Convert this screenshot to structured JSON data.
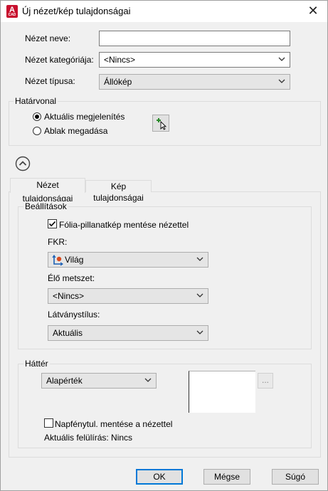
{
  "window": {
    "title": "Új nézet/kép tulajdonságai",
    "close_glyph": "✕",
    "app_icon_letter": "A",
    "app_icon_sub": "CAD"
  },
  "form": {
    "view_name_label": "Nézet neve:",
    "view_name_value": "",
    "view_category_label": "Nézet kategóriája:",
    "view_category_value": "<Nincs>",
    "view_type_label": "Nézet típusa:",
    "view_type_value": "Állókép"
  },
  "boundary": {
    "title": "Határvonal",
    "option_current": "Aktuális megjelenítés",
    "option_window": "Ablak megadása",
    "selected": "current"
  },
  "tabs": {
    "view_props": "Nézet tulajdonságai",
    "image_props": "Kép tulajdonságai",
    "active": "view_props"
  },
  "settings": {
    "title": "Beállítások",
    "save_layer_snapshot_label": "Fólia-pillanatkép mentése nézettel",
    "save_layer_snapshot_checked": true,
    "ucs_label": "FKR:",
    "ucs_value": "Világ",
    "live_section_label": "Élő metszet:",
    "live_section_value": "<Nincs>",
    "visual_style_label": "Látványstílus:",
    "visual_style_value": "Aktuális"
  },
  "background": {
    "title": "Háttér",
    "value": "Alapérték",
    "browse_label": "...",
    "save_sun_label": "Napfénytul. mentése a nézettel",
    "save_sun_checked": false,
    "current_override_label": "Aktuális felülírás: Nincs"
  },
  "buttons": {
    "ok": "OK",
    "cancel": "Mégse",
    "help": "Súgó"
  }
}
